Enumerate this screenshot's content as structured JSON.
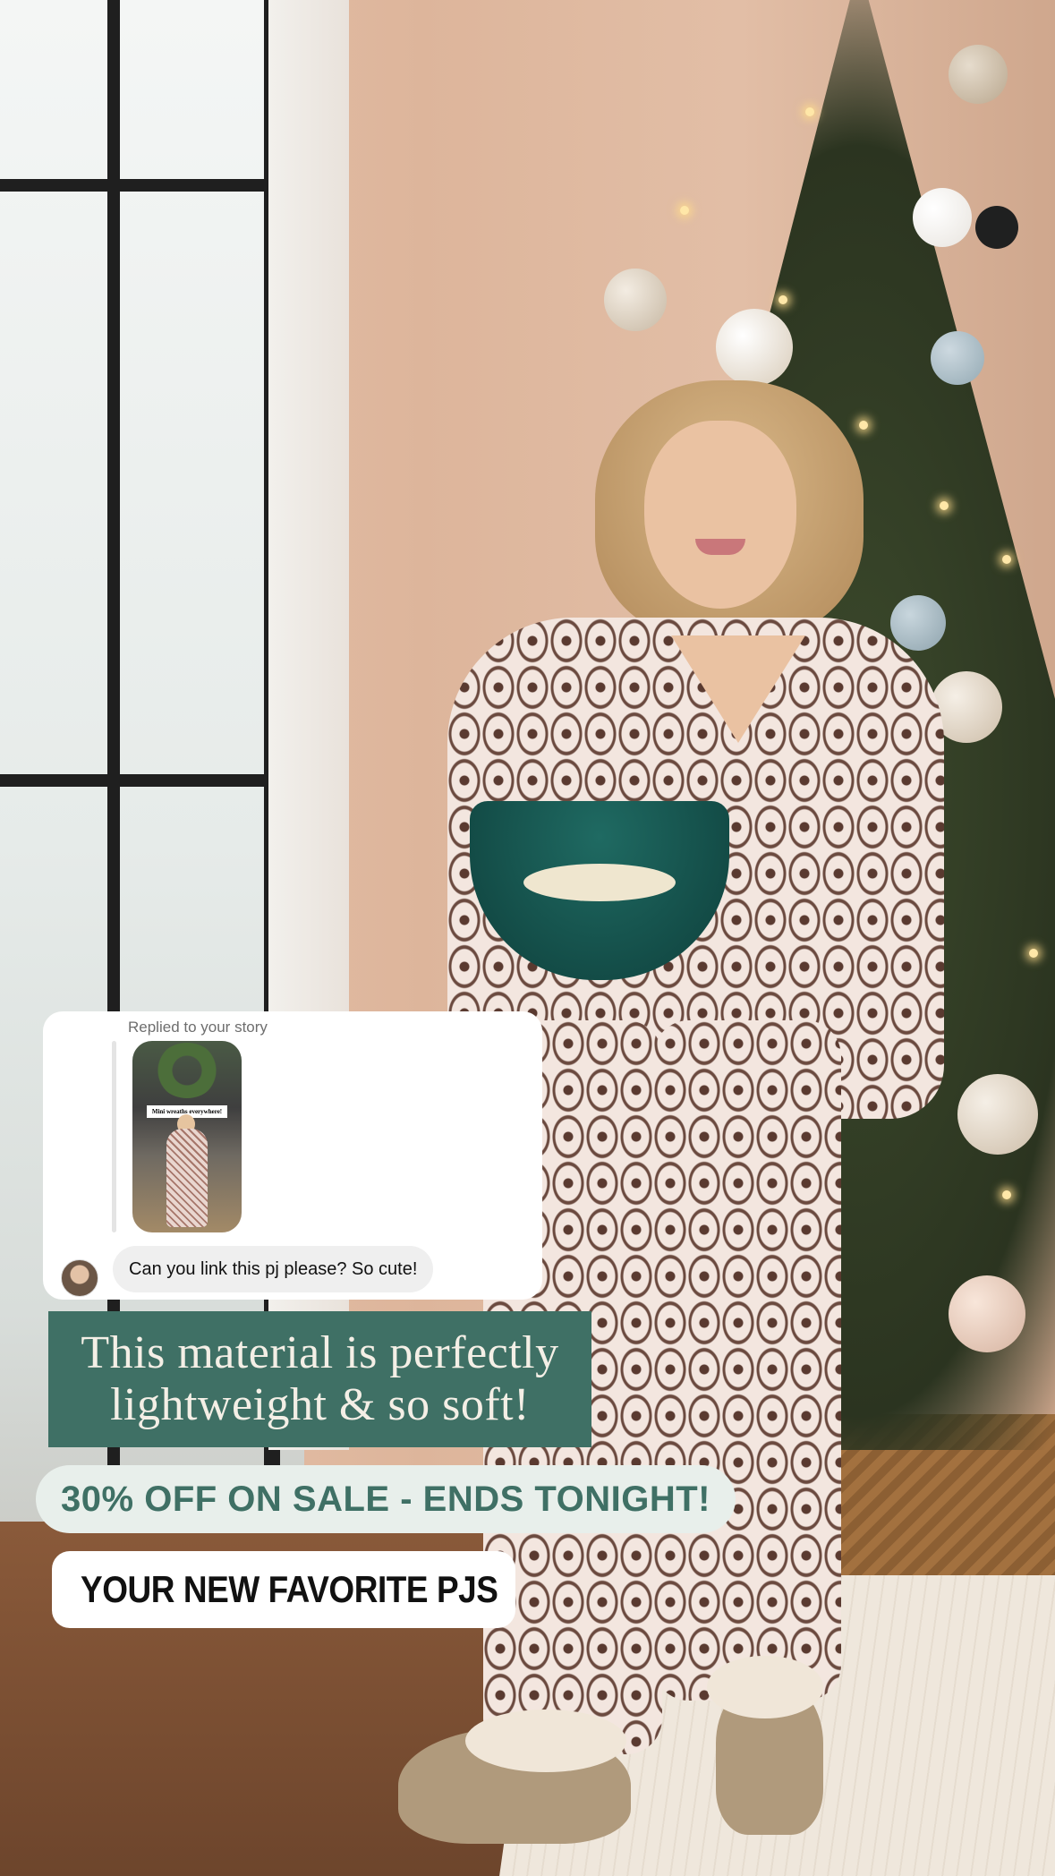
{
  "story_reply": {
    "label": "Replied to your story",
    "thumbnail_caption": "Mini wreaths everywhere!",
    "message": "Can you link this pj please? So cute!"
  },
  "text_overlay": {
    "line1": "This material is perfectly",
    "line2": "lightweight & so soft!"
  },
  "sale_banner": {
    "text": "30% OFF ON SALE - ENDS TONIGHT!"
  },
  "link_sticker": {
    "icon": "link-icon",
    "text": "YOUR NEW FAVORITE PJS"
  },
  "colors": {
    "accent_green": "#3f7065",
    "pill_bg": "#e8efeb",
    "link_gradient": [
      "#f5a623",
      "#e1306c",
      "#833ab4"
    ]
  }
}
